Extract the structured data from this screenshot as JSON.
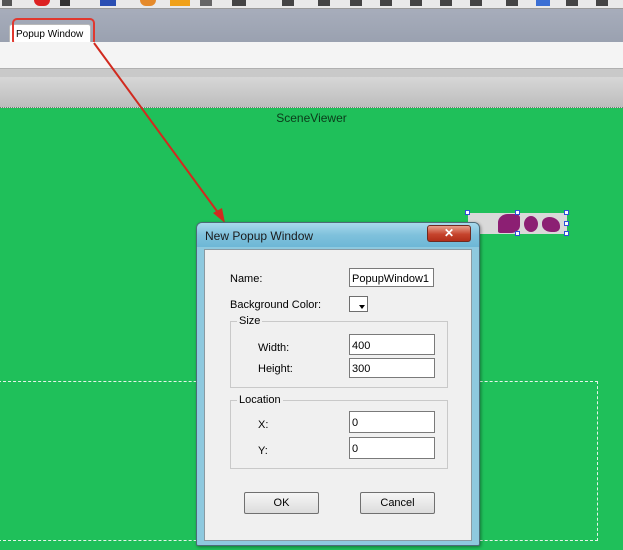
{
  "tab": {
    "label": "Popup Window"
  },
  "scene": {
    "title": "SceneViewer"
  },
  "dialog": {
    "title": "New Popup Window",
    "close_glyph": "✕",
    "name_label": "Name:",
    "name_value": "PopupWindow1",
    "bgcolor_label": "Background Color:",
    "size_legend": "Size",
    "width_label": "Width:",
    "width_value": "400",
    "height_label": "Height:",
    "height_value": "300",
    "location_legend": "Location",
    "x_label": "X:",
    "x_value": "0",
    "y_label": "Y:",
    "y_value": "0",
    "ok_label": "OK",
    "cancel_label": "Cancel"
  },
  "colors": {
    "scene_background": "#1fc05a",
    "annotation": "#e0382f",
    "graphic_mark": "#8c1f73"
  },
  "icons": [
    "toolbar-icon",
    "stop-icon",
    "close-icon",
    "dropdown-arrow-icon",
    "annotation-arrow-icon"
  ]
}
